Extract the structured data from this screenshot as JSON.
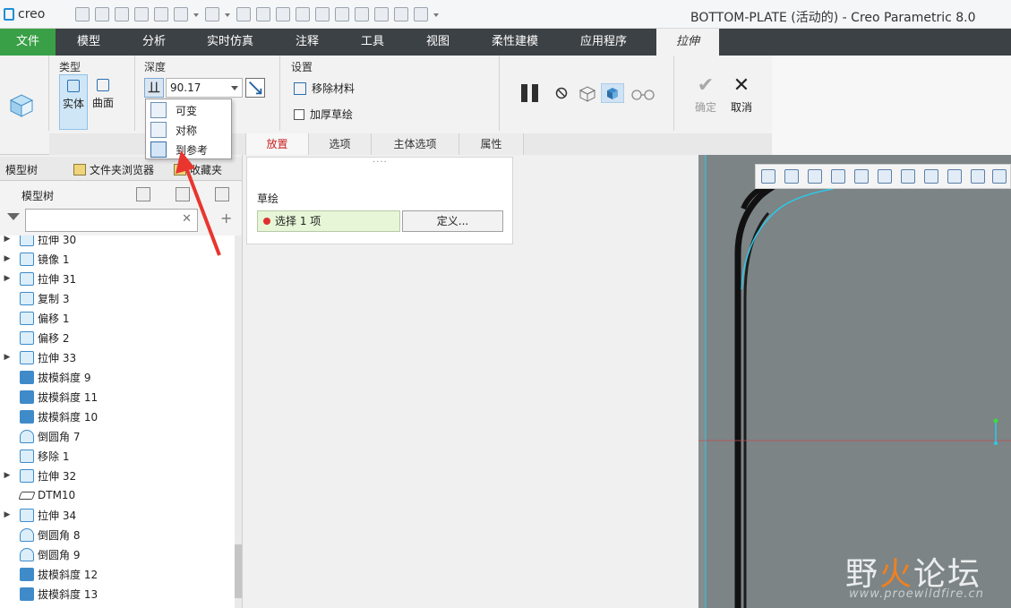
{
  "app": {
    "logo": "creo",
    "window_title": "BOTTOM-PLATE (活动的) - Creo Parametric 8.0"
  },
  "ribbon_tabs": [
    "文件",
    "模型",
    "分析",
    "实时仿真",
    "注释",
    "工具",
    "视图",
    "柔性建模",
    "应用程序",
    "拉伸"
  ],
  "ribbon": {
    "group_type": "类型",
    "type_solid": "实体",
    "type_surface": "曲面",
    "group_depth": "深度",
    "depth_value": "90.17",
    "group_settings": "设置",
    "remove_material": "移除材料",
    "thicken_sketch": "加厚草绘",
    "ok": "确定",
    "cancel": "取消"
  },
  "depth_menu": [
    "可变",
    "对称",
    "到参考"
  ],
  "sub_tabs": [
    "放置",
    "选项",
    "主体选项",
    "属性"
  ],
  "navigator": {
    "tabs": [
      "模型树",
      "文件夹浏览器",
      "收藏夹"
    ],
    "tree_label": "模型树",
    "filter_value": ""
  },
  "tree_items": [
    {
      "label": "拉伸 30",
      "expandable": true,
      "icon": "extrude-icon"
    },
    {
      "label": "镜像 1",
      "expandable": true,
      "icon": "mirror-icon"
    },
    {
      "label": "拉伸 31",
      "expandable": true,
      "icon": "extrude-icon"
    },
    {
      "label": "复制 3",
      "expandable": false,
      "icon": "copy-icon"
    },
    {
      "label": "偏移 1",
      "expandable": false,
      "icon": "offset-icon"
    },
    {
      "label": "偏移 2",
      "expandable": false,
      "icon": "offset-icon"
    },
    {
      "label": "拉伸 33",
      "expandable": true,
      "icon": "extrude-icon"
    },
    {
      "label": "拔模斜度 9",
      "expandable": false,
      "icon": "draft-icon"
    },
    {
      "label": "拔模斜度 11",
      "expandable": false,
      "icon": "draft-icon"
    },
    {
      "label": "拔模斜度 10",
      "expandable": false,
      "icon": "draft-icon"
    },
    {
      "label": "倒圆角 7",
      "expandable": false,
      "icon": "round-icon"
    },
    {
      "label": "移除 1",
      "expandable": false,
      "icon": "remove-icon"
    },
    {
      "label": "拉伸 32",
      "expandable": true,
      "icon": "extrude-icon"
    },
    {
      "label": "DTM10",
      "expandable": false,
      "icon": "datum-plane-icon"
    },
    {
      "label": "拉伸 34",
      "expandable": true,
      "icon": "extrude-icon"
    },
    {
      "label": "倒圆角 8",
      "expandable": false,
      "icon": "round-icon"
    },
    {
      "label": "倒圆角 9",
      "expandable": false,
      "icon": "round-icon"
    },
    {
      "label": "拔模斜度 12",
      "expandable": false,
      "icon": "draft-icon"
    },
    {
      "label": "拔模斜度 13",
      "expandable": false,
      "icon": "draft-icon"
    }
  ],
  "placement_panel": {
    "sketch_label": "草绘",
    "collector_text": "选择 1 项",
    "define_button": "定义..."
  },
  "watermark": {
    "text_part1": "野",
    "text_fire": "火",
    "text_part2": "论坛",
    "url": "www.proewildfire.cn"
  },
  "colors": {
    "file_tab": "#3aa047",
    "tabbar": "#3c4145",
    "active_subtab": "#c81e1e",
    "collector_bg": "#e6f6d6",
    "graphics_bg": "#7c8486"
  }
}
